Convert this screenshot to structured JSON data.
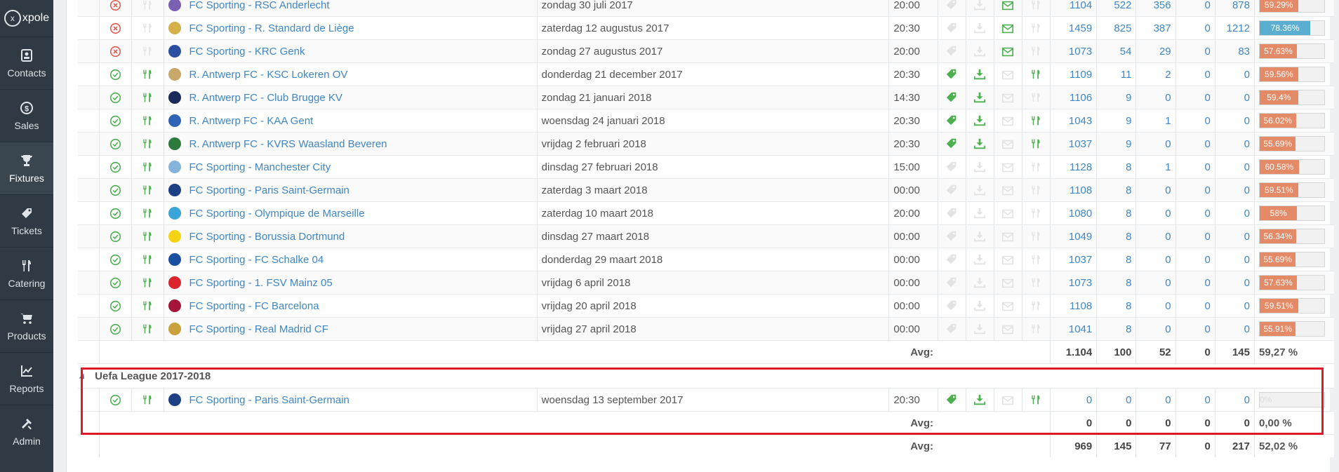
{
  "sidebar": {
    "logo_text": "xpole",
    "items": [
      {
        "label": "Contacts",
        "icon": "contacts-icon",
        "active": false
      },
      {
        "label": "Sales",
        "icon": "dollar-icon",
        "active": false
      },
      {
        "label": "Fixtures",
        "icon": "trophy-icon",
        "active": true
      },
      {
        "label": "Tickets",
        "icon": "ticket-icon",
        "active": false
      },
      {
        "label": "Catering",
        "icon": "cutlery-icon",
        "active": false
      },
      {
        "label": "Products",
        "icon": "cart-icon",
        "active": false
      },
      {
        "label": "Reports",
        "icon": "chart-icon",
        "active": false
      },
      {
        "label": "Admin",
        "icon": "tools-icon",
        "active": false
      }
    ]
  },
  "colors": {
    "link": "#3f86c5",
    "status_ok": "#4caf50",
    "status_cancel": "#e05a4f",
    "pct_orange": "#e58a67",
    "pct_blue": "#5aaed0",
    "highlight": "#e0192a"
  },
  "fixtures": [
    {
      "status": "cancel",
      "catering": false,
      "match": "FC Sporting - RSC Anderlecht",
      "date": "zondag 30 juli 2017",
      "time": "20:00",
      "tag": false,
      "dl": false,
      "mail": true,
      "cat2": false,
      "n1": "1104",
      "n2": "522",
      "n3": "356",
      "n4": "0",
      "n5": "878",
      "pct": "59.29%",
      "pct_value": 59.29,
      "pct_color": "orange"
    },
    {
      "status": "cancel",
      "catering": false,
      "match": "FC Sporting - R. Standard de Liège",
      "date": "zaterdag 12 augustus 2017",
      "time": "20:30",
      "tag": false,
      "dl": false,
      "mail": true,
      "cat2": false,
      "n1": "1459",
      "n2": "825",
      "n3": "387",
      "n4": "0",
      "n5": "1212",
      "pct": "78.36%",
      "pct_value": 78.36,
      "pct_color": "blue"
    },
    {
      "status": "cancel",
      "catering": false,
      "match": "FC Sporting - KRC Genk",
      "date": "zondag 27 augustus 2017",
      "time": "20:00",
      "tag": false,
      "dl": false,
      "mail": true,
      "cat2": false,
      "n1": "1073",
      "n2": "54",
      "n3": "29",
      "n4": "0",
      "n5": "83",
      "pct": "57.63%",
      "pct_value": 57.63,
      "pct_color": "orange"
    },
    {
      "status": "ok",
      "catering": true,
      "match": "R. Antwerp FC - KSC Lokeren OV",
      "date": "donderdag 21 december 2017",
      "time": "20:30",
      "tag": true,
      "dl": true,
      "mail": false,
      "cat2": true,
      "n1": "1109",
      "n2": "11",
      "n3": "2",
      "n4": "0",
      "n5": "0",
      "pct": "59.56%",
      "pct_value": 59.56,
      "pct_color": "orange"
    },
    {
      "status": "ok",
      "catering": true,
      "match": "R. Antwerp FC - Club Brugge KV",
      "date": "zondag 21 januari 2018",
      "time": "14:30",
      "tag": true,
      "dl": true,
      "mail": false,
      "cat2": false,
      "n1": "1106",
      "n2": "9",
      "n3": "0",
      "n4": "0",
      "n5": "0",
      "pct": "59.4%",
      "pct_value": 59.4,
      "pct_color": "orange"
    },
    {
      "status": "ok",
      "catering": true,
      "match": "R. Antwerp FC - KAA Gent",
      "date": "woensdag 24 januari 2018",
      "time": "20:30",
      "tag": true,
      "dl": true,
      "mail": false,
      "cat2": true,
      "n1": "1043",
      "n2": "9",
      "n3": "1",
      "n4": "0",
      "n5": "0",
      "pct": "56.02%",
      "pct_value": 56.02,
      "pct_color": "orange"
    },
    {
      "status": "ok",
      "catering": true,
      "match": "R. Antwerp FC - KVRS Waasland Beveren",
      "date": "vrijdag 2 februari 2018",
      "time": "20:30",
      "tag": true,
      "dl": true,
      "mail": false,
      "cat2": true,
      "n1": "1037",
      "n2": "9",
      "n3": "0",
      "n4": "0",
      "n5": "0",
      "pct": "55.69%",
      "pct_value": 55.69,
      "pct_color": "orange"
    },
    {
      "status": "ok",
      "catering": true,
      "match": "FC Sporting - Manchester City",
      "date": "dinsdag 27 februari 2018",
      "time": "15:00",
      "tag": false,
      "dl": false,
      "mail": false,
      "cat2": false,
      "n1": "1128",
      "n2": "8",
      "n3": "1",
      "n4": "0",
      "n5": "0",
      "pct": "60.58%",
      "pct_value": 60.58,
      "pct_color": "orange"
    },
    {
      "status": "ok",
      "catering": true,
      "match": "FC Sporting - Paris Saint-Germain",
      "date": "zaterdag 3 maart 2018",
      "time": "00:00",
      "tag": false,
      "dl": false,
      "mail": false,
      "cat2": false,
      "n1": "1108",
      "n2": "8",
      "n3": "0",
      "n4": "0",
      "n5": "0",
      "pct": "59.51%",
      "pct_value": 59.51,
      "pct_color": "orange"
    },
    {
      "status": "ok",
      "catering": true,
      "match": "FC Sporting - Olympique de Marseille",
      "date": "zaterdag 10 maart 2018",
      "time": "20:00",
      "tag": false,
      "dl": false,
      "mail": false,
      "cat2": false,
      "n1": "1080",
      "n2": "8",
      "n3": "0",
      "n4": "0",
      "n5": "0",
      "pct": "58%",
      "pct_value": 58,
      "pct_color": "orange"
    },
    {
      "status": "ok",
      "catering": true,
      "match": "FC Sporting - Borussia Dortmund",
      "date": "dinsdag 27 maart 2018",
      "time": "00:00",
      "tag": false,
      "dl": false,
      "mail": false,
      "cat2": false,
      "n1": "1049",
      "n2": "8",
      "n3": "0",
      "n4": "0",
      "n5": "0",
      "pct": "56.34%",
      "pct_value": 56.34,
      "pct_color": "orange"
    },
    {
      "status": "ok",
      "catering": true,
      "match": "FC Sporting - FC Schalke 04",
      "date": "donderdag 29 maart 2018",
      "time": "00:00",
      "tag": false,
      "dl": false,
      "mail": false,
      "cat2": false,
      "n1": "1037",
      "n2": "8",
      "n3": "0",
      "n4": "0",
      "n5": "0",
      "pct": "55.69%",
      "pct_value": 55.69,
      "pct_color": "orange"
    },
    {
      "status": "ok",
      "catering": true,
      "match": "FC Sporting - 1. FSV Mainz 05",
      "date": "vrijdag 6 april 2018",
      "time": "00:00",
      "tag": false,
      "dl": false,
      "mail": false,
      "cat2": false,
      "n1": "1073",
      "n2": "8",
      "n3": "0",
      "n4": "0",
      "n5": "0",
      "pct": "57.63%",
      "pct_value": 57.63,
      "pct_color": "orange"
    },
    {
      "status": "ok",
      "catering": true,
      "match": "FC Sporting - FC Barcelona",
      "date": "vrijdag 20 april 2018",
      "time": "00:00",
      "tag": false,
      "dl": false,
      "mail": false,
      "cat2": false,
      "n1": "1108",
      "n2": "8",
      "n3": "0",
      "n4": "0",
      "n5": "0",
      "pct": "59.51%",
      "pct_value": 59.51,
      "pct_color": "orange"
    },
    {
      "status": "ok",
      "catering": true,
      "match": "FC Sporting - Real Madrid CF",
      "date": "vrijdag 27 april 2018",
      "time": "00:00",
      "tag": false,
      "dl": false,
      "mail": false,
      "cat2": false,
      "n1": "1041",
      "n2": "8",
      "n3": "0",
      "n4": "0",
      "n5": "0",
      "pct": "55.91%",
      "pct_value": 55.91,
      "pct_color": "orange"
    }
  ],
  "league_avg": {
    "label": "Avg:",
    "n1": "1.104",
    "n2": "100",
    "n3": "52",
    "n4": "0",
    "n5": "145",
    "pct": "59,27 %"
  },
  "uefa_group": {
    "title": "Uefa League 2017-2018",
    "fixture": {
      "status": "ok",
      "catering": true,
      "match": "FC Sporting - Paris Saint-Germain",
      "date": "woensdag 13 september 2017",
      "time": "20:30",
      "tag": true,
      "dl": true,
      "mail": false,
      "cat2": true,
      "n1": "0",
      "n2": "0",
      "n3": "0",
      "n4": "0",
      "n5": "0",
      "pct": "0%",
      "pct_value": 0
    },
    "avg": {
      "label": "Avg:",
      "n1": "0",
      "n2": "0",
      "n3": "0",
      "n4": "0",
      "n5": "0",
      "pct": "0,00 %"
    }
  },
  "total_avg": {
    "label": "Avg:",
    "n1": "969",
    "n2": "145",
    "n3": "77",
    "n4": "0",
    "n5": "217",
    "pct": "52,02 %"
  }
}
